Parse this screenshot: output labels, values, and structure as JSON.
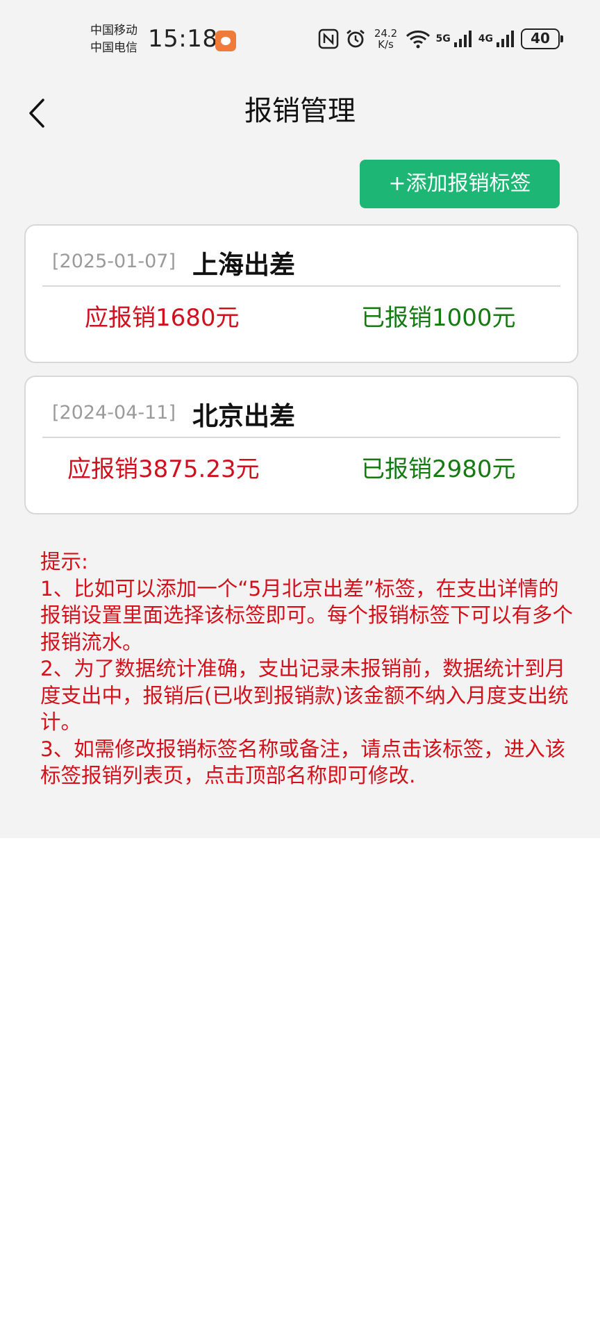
{
  "status_bar": {
    "carrier_1": "中国移动",
    "carrier_2": "中国电信",
    "time": "15:18",
    "speed_value": "24.2",
    "speed_unit": "K/s",
    "network_1": "5G",
    "network_2": "4G",
    "battery": "40",
    "icons": [
      "app-badge-icon",
      "nfc-icon",
      "alarm-icon",
      "wifi-icon",
      "signal-icon",
      "signal-icon",
      "battery-icon"
    ]
  },
  "nav": {
    "title": "报销管理",
    "back_icon": "chevron-left-icon"
  },
  "add_tag_button": "+添加报销标签",
  "cards": [
    {
      "date": "[2025-01-07]",
      "name": "上海出差",
      "due": "应报销1680元",
      "paid": "已报销1000元"
    },
    {
      "date": "[2024-04-11]",
      "name": "北京出差",
      "due": "应报销3875.23元",
      "paid": "已报销2980元"
    }
  ],
  "tips": {
    "title": "提示:",
    "item_1": "1、比如可以添加一个“5月北京出差”标签，在支出详情的报销设置里面选择该标签即可。每个报销标签下可以有多个报销流水。",
    "item_2": "2、为了数据统计准确，支出记录未报销前，数据统计到月度支出中，报销后(已收到报销款)该金额不纳入月度支出统计。",
    "item_3": "3、如需修改报销标签名称或备注，请点击该标签，进入该标签报销列表页，点击顶部名称即可修改."
  },
  "colors": {
    "accent_green": "#1eb675",
    "due_red": "#d0101e",
    "paid_green": "#157a12",
    "tip_red": "#d4101b",
    "background": "#f3f3f3"
  }
}
